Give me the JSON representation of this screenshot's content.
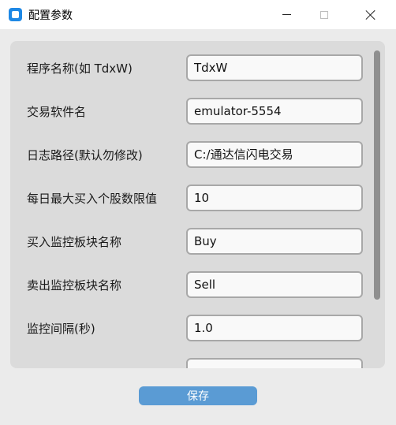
{
  "window": {
    "title": "配置参数"
  },
  "form": {
    "fields": [
      {
        "label": "程序名称(如 TdxW)",
        "value": "TdxW"
      },
      {
        "label": "交易软件名",
        "value": "emulator-5554"
      },
      {
        "label": "日志路径(默认勿修改)",
        "value": "C:/通达信闪电交易"
      },
      {
        "label": "每日最大买入个股数限值",
        "value": "10"
      },
      {
        "label": "买入监控板块名称",
        "value": "Buy"
      },
      {
        "label": "卖出监控板块名称",
        "value": "Sell"
      },
      {
        "label": "监控间隔(秒)",
        "value": "1.0"
      },
      {
        "label": "",
        "value": ""
      }
    ]
  },
  "actions": {
    "save_label": "保存"
  }
}
